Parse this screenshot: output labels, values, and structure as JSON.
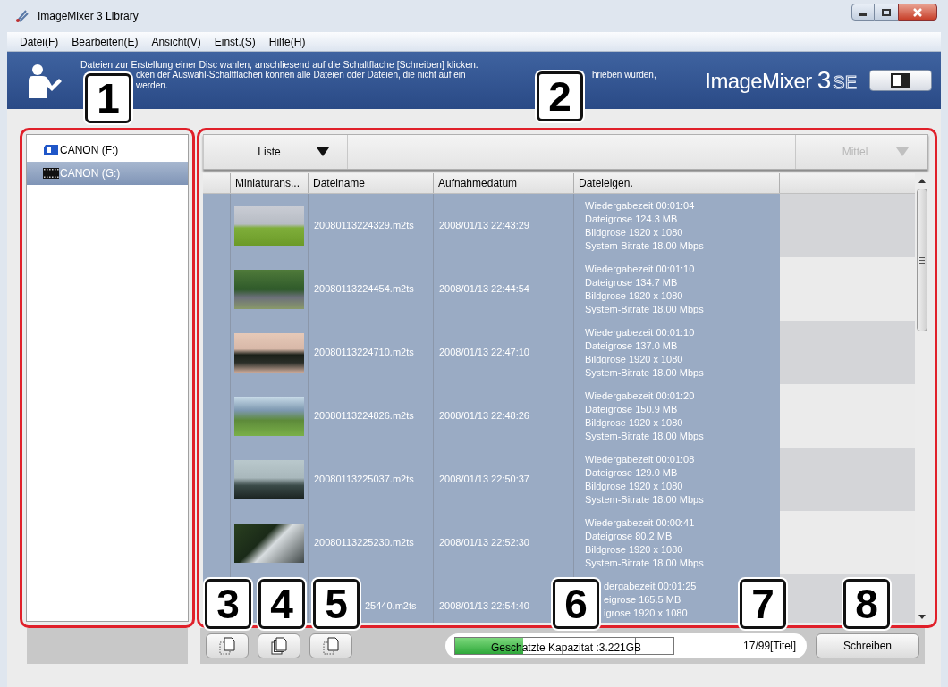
{
  "window": {
    "title": "ImageMixer 3 Library"
  },
  "menu": [
    "Datei(F)",
    "Bearbeiten(E)",
    "Ansicht(V)",
    "Einst.(S)",
    "Hilfe(H)"
  ],
  "banner": {
    "line_1": "Dateien zur Erstellung einer Disc wahlen, anschliesend auf die Schaltflache [Schreiben] klicken.",
    "line_2_start": "cken der Auswahl-Schaltflachen konnen alle Dateien oder Dateien, die nicht auf ein",
    "line_2_end": "hrieben wurden,",
    "line_3": "werden.",
    "logo": {
      "name": "ImageMixer",
      "version": "3",
      "edition": "SE"
    }
  },
  "sources": [
    {
      "label": "CANON (F:)",
      "kind": "card",
      "selected": false
    },
    {
      "label": "CANON (G:)",
      "kind": "film",
      "selected": true
    }
  ],
  "view_dropdown": {
    "value": "Liste",
    "disabled": false
  },
  "size_dropdown": {
    "value": "Mittel",
    "disabled": true
  },
  "table": {
    "columns": [
      "Miniaturans...",
      "Dateiname",
      "Aufnahmedatum",
      "Dateieigen."
    ],
    "rows": [
      {
        "kind": "full",
        "selected": true,
        "filename": "20080113224329.m2ts",
        "date": "2008/01/13 22:43:29",
        "properties": [
          "Wiedergabezeit 00:01:04",
          "Dateigrose 124.3 MB",
          "Bildgrose 1920 x 1080",
          "System-Bitrate 18.00 Mbps"
        ]
      },
      {
        "kind": "full",
        "selected": true,
        "filename": "20080113224454.m2ts",
        "date": "2008/01/13 22:44:54",
        "properties": [
          "Wiedergabezeit 00:01:10",
          "Dateigrose 134.7 MB",
          "Bildgrose 1920 x 1080",
          "System-Bitrate 18.00 Mbps"
        ]
      },
      {
        "kind": "full",
        "selected": true,
        "filename": "20080113224710.m2ts",
        "date": "2008/01/13 22:47:10",
        "properties": [
          "Wiedergabezeit 00:01:10",
          "Dateigrose 137.0 MB",
          "Bildgrose 1920 x 1080",
          "System-Bitrate 18.00 Mbps"
        ]
      },
      {
        "kind": "full",
        "selected": true,
        "filename": "20080113224826.m2ts",
        "date": "2008/01/13 22:48:26",
        "properties": [
          "Wiedergabezeit 00:01:20",
          "Dateigrose 150.9 MB",
          "Bildgrose 1920 x 1080",
          "System-Bitrate 18.00 Mbps"
        ]
      },
      {
        "kind": "full",
        "selected": true,
        "filename": "20080113225037.m2ts",
        "date": "2008/01/13 22:50:37",
        "properties": [
          "Wiedergabezeit 00:01:08",
          "Dateigrose 129.0 MB",
          "Bildgrose 1920 x 1080",
          "System-Bitrate 18.00 Mbps"
        ]
      },
      {
        "kind": "full",
        "selected": true,
        "filename": "20080113225230.m2ts",
        "date": "2008/01/13 22:52:30",
        "properties": [
          "Wiedergabezeit 00:00:41",
          "Dateigrose 80.2 MB",
          "Bildgrose 1920 x 1080",
          "System-Bitrate 18.00 Mbps"
        ]
      },
      {
        "kind": "cut",
        "selected": true,
        "filename": "25440.m2ts",
        "date": "2008/01/13 22:54:40",
        "properties": [
          "dergabezeit 00:01:25",
          "eigrose 165.5 MB",
          "igrose 1920 x 1080"
        ]
      }
    ]
  },
  "capacity": {
    "label": "Geschatzte Kapazitat :3.221GB",
    "level": 0.31,
    "count": "17/99[Titel]"
  },
  "write_button": "Schreiben",
  "callouts": [
    "1",
    "2",
    "3",
    "4",
    "5",
    "6",
    "7",
    "8"
  ]
}
